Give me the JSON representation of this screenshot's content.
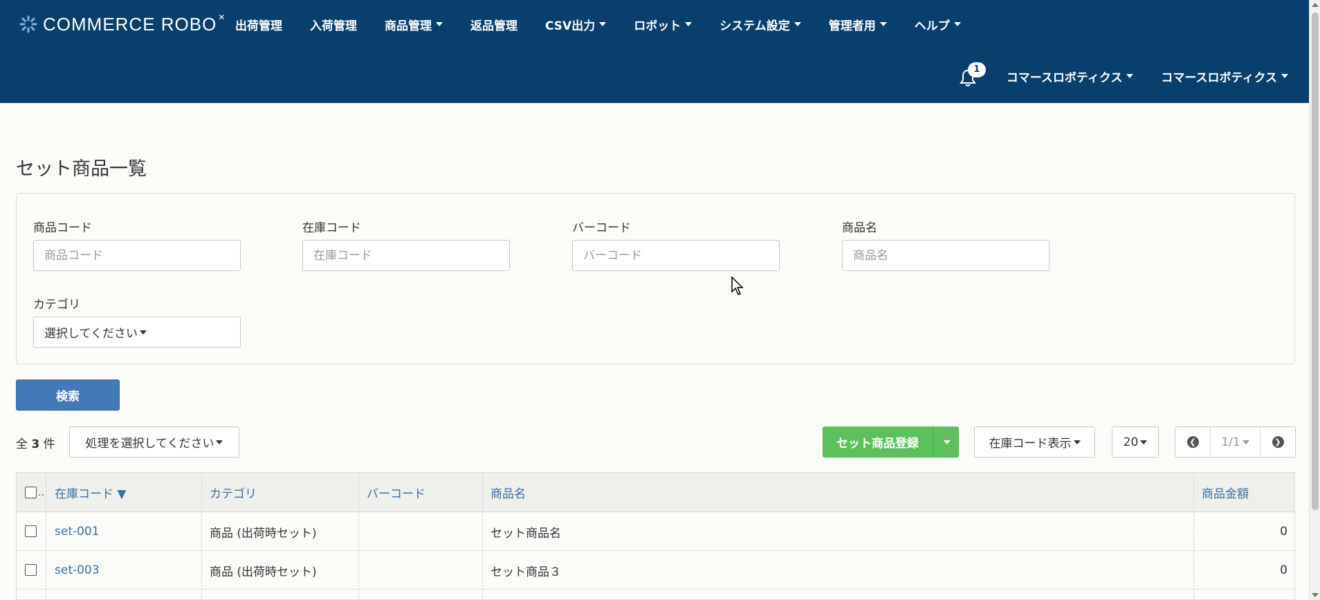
{
  "brand": {
    "name": "COMMERCE ROBO"
  },
  "nav": {
    "items": [
      {
        "label": "出荷管理",
        "dropdown": false
      },
      {
        "label": "入荷管理",
        "dropdown": false
      },
      {
        "label": "商品管理",
        "dropdown": true
      },
      {
        "label": "返品管理",
        "dropdown": false
      },
      {
        "label": "CSV出力",
        "dropdown": true
      },
      {
        "label": "ロボット",
        "dropdown": true
      },
      {
        "label": "システム設定",
        "dropdown": true
      },
      {
        "label": "管理者用",
        "dropdown": true
      },
      {
        "label": "ヘルプ",
        "dropdown": true
      }
    ]
  },
  "user_nav": {
    "notification_count": "1",
    "company_label": "コマースロボティクス",
    "user_label": "コマースロボティクス"
  },
  "page": {
    "title": "セット商品一覧"
  },
  "filters": {
    "product_code": {
      "label": "商品コード",
      "placeholder": "商品コード",
      "value": ""
    },
    "stock_code": {
      "label": "在庫コード",
      "placeholder": "在庫コード",
      "value": ""
    },
    "barcode": {
      "label": "バーコード",
      "placeholder": "バーコード",
      "value": ""
    },
    "product_name": {
      "label": "商品名",
      "placeholder": "商品名",
      "value": ""
    },
    "category": {
      "label": "カテゴリ",
      "selected": "選択してください"
    },
    "search_button": "検索"
  },
  "toolbar": {
    "total_prefix": "全",
    "total_count": "3",
    "total_suffix": "件",
    "bulk_action": "処理を選択してください",
    "register_button": "セット商品登録",
    "code_display": "在庫コード表示",
    "page_size": "20",
    "page_indicator": "1/1"
  },
  "table": {
    "headers": {
      "checkbox_more": "..",
      "stock_code": "在庫コード ▼",
      "category": "カテゴリ",
      "barcode": "バーコード",
      "product_name": "商品名",
      "price": "商品金額"
    },
    "rows": [
      {
        "stock_code": "set-001",
        "category": "商品 (出荷時セット)",
        "barcode": "",
        "product_name": "セット商品名",
        "price": "0"
      },
      {
        "stock_code": "set-003",
        "category": "商品 (出荷時セット)",
        "barcode": "",
        "product_name": "セット商品３",
        "price": "0"
      }
    ]
  },
  "colors": {
    "header_bg": "#083f6d",
    "primary": "#4279b6",
    "success": "#5cc15c",
    "link": "#3a6ea5"
  }
}
